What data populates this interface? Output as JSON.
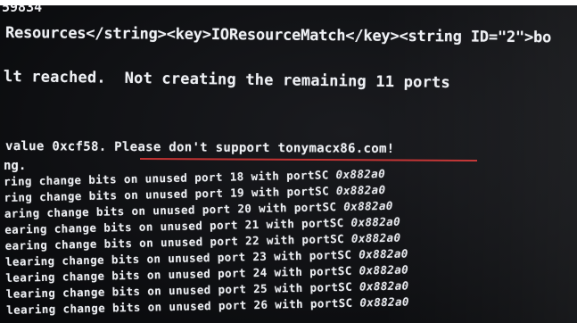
{
  "screen": {
    "top_clip": "59834",
    "resources_line": "Resources</string><key>IOResourceMatch</key><string ID=\"2\">bo",
    "limit_line": "lt reached.  Not creating the remaining 11 ports",
    "value_prefix": "value 0xcf58. ",
    "value_message": "Please don't support tonymacx86.com!",
    "ng_line": "ng.",
    "underline_color": "#c43434",
    "port_lines": [
      {
        "prefix": "ring change bits on unused port 18 with portSC ",
        "hex": "0x882a0"
      },
      {
        "prefix": "ring change bits on unused port 19 with portSC ",
        "hex": "0x882a0"
      },
      {
        "prefix": "aring change bits on unused port 20 with portSC ",
        "hex": "0x882a0"
      },
      {
        "prefix": "earing change bits on unused port 21 with portSC ",
        "hex": "0x882a0"
      },
      {
        "prefix": "earing change bits on unused port 22 with portSC ",
        "hex": "0x882a0"
      },
      {
        "prefix": "learing change bits on unused port 23 with portSC ",
        "hex": "0x882a0"
      },
      {
        "prefix": "learing change bits on unused port 24 with portSC ",
        "hex": "0x882a0"
      },
      {
        "prefix": "learing change bits on unused port 25 with portSC ",
        "hex": "0x882a0"
      },
      {
        "prefix": "learing change bits on unused port 26 with portSC ",
        "hex": "0x882a0"
      }
    ]
  }
}
